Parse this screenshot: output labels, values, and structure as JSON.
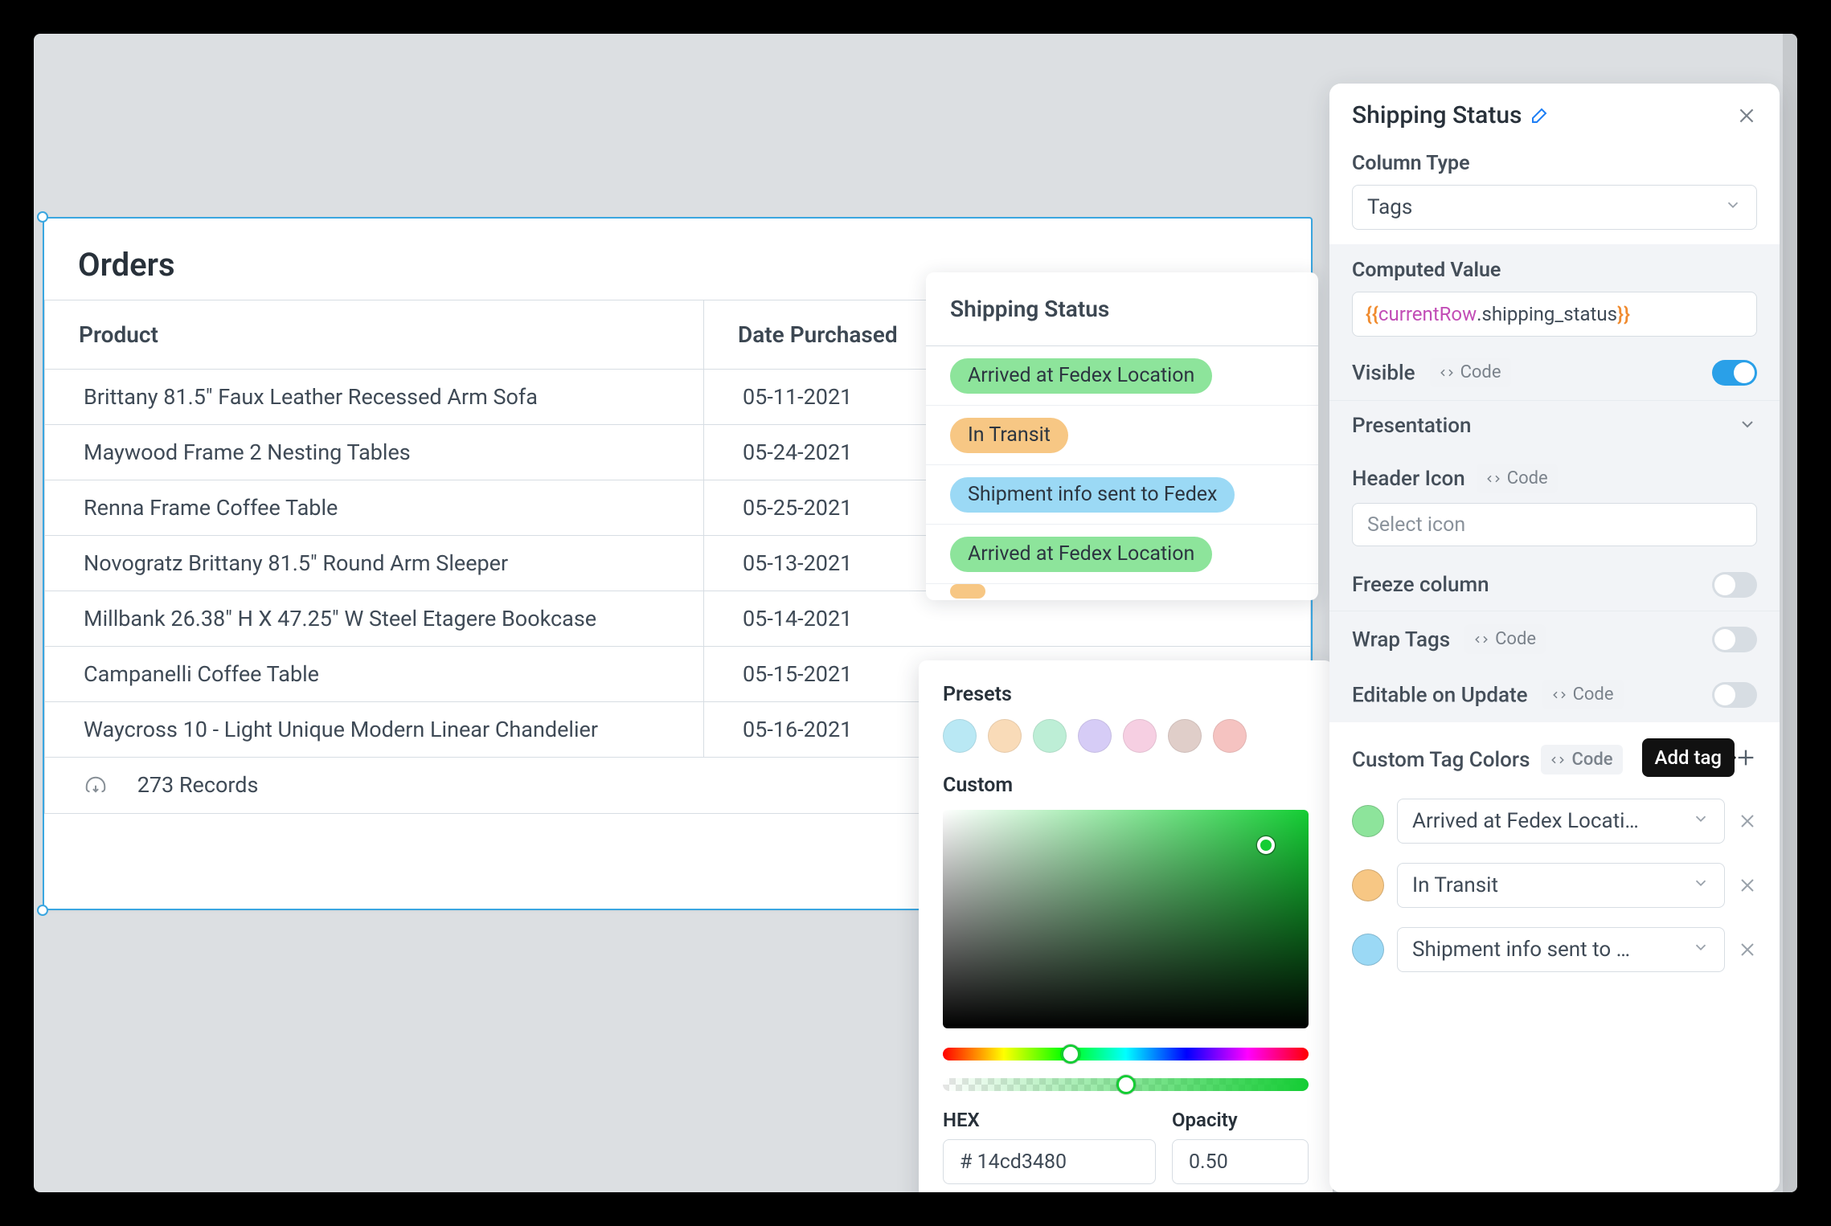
{
  "table": {
    "title": "Orders",
    "columns": {
      "product": "Product",
      "date": "Date Purchased"
    },
    "rows": [
      {
        "product": "Brittany 81.5\" Faux Leather Recessed Arm Sofa",
        "date": "05-11-2021"
      },
      {
        "product": "Maywood Frame 2 Nesting Tables",
        "date": "05-24-2021"
      },
      {
        "product": "Renna Frame Coffee Table",
        "date": "05-25-2021"
      },
      {
        "product": "Novogratz Brittany 81.5\" Round Arm Sleeper",
        "date": "05-13-2021"
      },
      {
        "product": "Millbank 26.38\" H X 47.25\" W Steel Etagere Bookcase",
        "date": "05-14-2021"
      },
      {
        "product": "Campanelli Coffee Table",
        "date": "05-15-2021"
      },
      {
        "product": "Waycross 10 - Light Unique Modern Linear Chandelier",
        "date": "05-16-2021"
      }
    ],
    "records_label": "273 Records"
  },
  "ship_col": {
    "header": "Shipping Status",
    "rows": [
      {
        "label": "Arrived at Fedex Location",
        "cls": "green"
      },
      {
        "label": "In Transit",
        "cls": "orange"
      },
      {
        "label": "Shipment info sent to Fedex",
        "cls": "blue"
      },
      {
        "label": "Arrived at Fedex Location",
        "cls": "green"
      }
    ]
  },
  "picker": {
    "presets_label": "Presets",
    "custom_label": "Custom",
    "preset_colors": [
      "#b9e8f4",
      "#f9dbb8",
      "#bdeed6",
      "#d6ccf6",
      "#f6cfe2",
      "#e0cec9",
      "#f5c3c1"
    ],
    "hex_label": "HEX",
    "hex_value": "# 14cd3480",
    "opacity_label": "Opacity",
    "opacity_value": "0.50"
  },
  "panel": {
    "title": "Shipping Status",
    "column_type_label": "Column Type",
    "column_type_value": "Tags",
    "computed_label": "Computed Value",
    "computed_expr": {
      "open": "{{",
      "kw": "currentRow",
      "rest": ".shipping_status ",
      "close": "}}"
    },
    "visible_label": "Visible",
    "code_chip": "Code",
    "presentation_label": "Presentation",
    "header_icon_label": "Header Icon",
    "header_icon_placeholder": "Select icon",
    "freeze_label": "Freeze column",
    "wrap_label": "Wrap Tags",
    "editable_label": "Editable on Update",
    "custom_tag_label": "Custom Tag Colors",
    "add_tag_tooltip": "Add tag",
    "tag_rows": [
      {
        "color": "#8de49b",
        "label": "Arrived at Fedex Locati…"
      },
      {
        "color": "#f7c784",
        "label": "In Transit"
      },
      {
        "color": "#9bd9f5",
        "label": "Shipment info sent to …"
      }
    ]
  }
}
